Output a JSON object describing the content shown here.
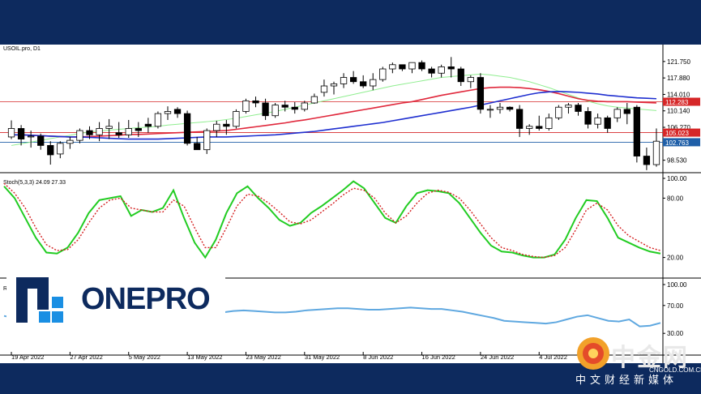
{
  "chart_data": [
    {
      "type": "candlestick",
      "title": "USOIL.pro, D1",
      "ylim": [
        95.6,
        124.2
      ],
      "y_ticks": [
        121.75,
        117.88,
        114.01,
        110.14,
        106.27,
        102.4,
        98.53
      ],
      "y_tick_labels": [
        "121.750",
        "117.880",
        "114.010",
        "110.140",
        "106.270",
        "",
        "98.530"
      ],
      "x_tick_labels": [
        "19 Apr 2022",
        "27 Apr 2022",
        "5 May 2022",
        "13 May 2022",
        "23 May 2022",
        "31 May 2022",
        "8 Jun 2022",
        "16 Jun 2022",
        "24 Jun 2022",
        "4 Jul 2022"
      ],
      "x_tick_index": [
        0,
        6,
        12,
        18,
        24,
        30,
        36,
        42,
        48,
        54
      ],
      "horizontal_lines": [
        {
          "value": 112.283,
          "label": "112.283",
          "color": "#d62728"
        },
        {
          "value": 105.023,
          "label": "105.023",
          "color": "#d62728"
        },
        {
          "value": 102.763,
          "label": "102.763",
          "color": "#1f5fa8"
        }
      ],
      "candles": [
        [
          104.0,
          107.9,
          103.5,
          106.0
        ],
        [
          106.0,
          106.8,
          102.0,
          103.5
        ],
        [
          104.0,
          105.5,
          101.5,
          104.2
        ],
        [
          104.2,
          104.8,
          101.0,
          102.0
        ],
        [
          102.0,
          103.0,
          97.5,
          99.8
        ],
        [
          100.0,
          103.0,
          99.0,
          102.5
        ],
        [
          102.5,
          104.0,
          101.2,
          103.2
        ],
        [
          103.2,
          106.0,
          102.5,
          105.5
        ],
        [
          105.5,
          106.5,
          103.5,
          104.5
        ],
        [
          104.5,
          107.5,
          103.0,
          106.0
        ],
        [
          106.0,
          108.2,
          103.5,
          106.5
        ],
        [
          105.0,
          107.5,
          103.8,
          104.5
        ],
        [
          104.5,
          108.0,
          103.8,
          106.0
        ],
        [
          106.0,
          107.5,
          104.0,
          105.5
        ],
        [
          107.0,
          108.5,
          105.0,
          106.5
        ],
        [
          106.5,
          110.0,
          106.0,
          109.5
        ],
        [
          109.5,
          111.2,
          108.0,
          110.0
        ],
        [
          110.5,
          111.0,
          108.5,
          109.5
        ],
        [
          109.5,
          110.2,
          102.0,
          102.5
        ],
        [
          102.5,
          104.0,
          101.0,
          101.0
        ],
        [
          101.0,
          106.0,
          100.0,
          105.5
        ],
        [
          105.5,
          107.8,
          104.0,
          107.0
        ],
        [
          107.0,
          108.0,
          104.5,
          106.5
        ],
        [
          106.5,
          110.5,
          106.0,
          110.0
        ],
        [
          110.0,
          113.0,
          109.5,
          112.5
        ],
        [
          112.5,
          113.5,
          111.0,
          112.0
        ],
        [
          112.0,
          113.0,
          108.0,
          109.0
        ],
        [
          109.0,
          112.0,
          108.5,
          111.5
        ],
        [
          111.5,
          112.5,
          110.0,
          111.0
        ],
        [
          111.0,
          112.2,
          109.5,
          110.5
        ],
        [
          110.5,
          112.5,
          110.0,
          112.0
        ],
        [
          112.0,
          114.2,
          111.8,
          113.5
        ],
        [
          114.5,
          117.5,
          113.5,
          116.0
        ],
        [
          116.0,
          117.0,
          114.0,
          116.5
        ],
        [
          116.5,
          119.0,
          115.5,
          118.0
        ],
        [
          118.0,
          119.5,
          116.5,
          117.0
        ],
        [
          117.0,
          118.5,
          115.5,
          116.0
        ],
        [
          116.0,
          119.0,
          115.0,
          117.5
        ],
        [
          117.5,
          120.5,
          117.0,
          120.0
        ],
        [
          120.0,
          121.5,
          119.0,
          121.0
        ],
        [
          121.0,
          121.0,
          119.5,
          120.0
        ],
        [
          120.0,
          121.5,
          119.0,
          121.5
        ],
        [
          121.5,
          122.0,
          119.5,
          120.0
        ],
        [
          120.0,
          120.5,
          118.0,
          119.0
        ],
        [
          119.0,
          121.0,
          118.0,
          120.5
        ],
        [
          120.5,
          122.8,
          118.0,
          120.0
        ],
        [
          120.0,
          120.5,
          116.0,
          117.0
        ],
        [
          117.0,
          118.5,
          115.5,
          118.0
        ],
        [
          118.0,
          119.0,
          109.5,
          110.5
        ],
        [
          110.5,
          111.5,
          108.5,
          110.5
        ],
        [
          110.5,
          112.0,
          109.5,
          111.0
        ],
        [
          111.0,
          111.2,
          110.0,
          110.5
        ],
        [
          110.5,
          111.5,
          104.0,
          106.0
        ],
        [
          106.0,
          107.0,
          104.5,
          106.5
        ],
        [
          106.5,
          109.0,
          105.5,
          106.0
        ],
        [
          106.0,
          109.5,
          105.5,
          108.5
        ],
        [
          108.5,
          111.5,
          108.0,
          111.0
        ],
        [
          111.0,
          112.0,
          109.5,
          111.5
        ],
        [
          111.5,
          112.0,
          109.0,
          110.0
        ],
        [
          110.0,
          111.0,
          106.0,
          107.0
        ],
        [
          107.0,
          109.5,
          106.0,
          108.5
        ],
        [
          108.5,
          109.0,
          105.0,
          106.0
        ],
        [
          108.5,
          111.0,
          107.5,
          110.5
        ],
        [
          110.5,
          112.0,
          107.0,
          109.5
        ],
        [
          111.0,
          111.5,
          98.0,
          99.5
        ],
        [
          99.5,
          101.5,
          96.2,
          97.5
        ],
        [
          97.5,
          106.0,
          97.0,
          103.0
        ]
      ],
      "series": [
        {
          "color": "#90ee90",
          "values": [
            102.0,
            102.4,
            102.8,
            103.2,
            103.6,
            104.0,
            104.4,
            104.8,
            105.2,
            105.4,
            105.6,
            105.8,
            106.0,
            106.2,
            106.3,
            106.5,
            106.8,
            107.0,
            107.2,
            107.4,
            107.6,
            107.8,
            108.1,
            108.4,
            108.8,
            109.2,
            109.6,
            110.0,
            110.5,
            111.0,
            111.5,
            112.0,
            112.5,
            113.0,
            113.5,
            114.0,
            114.5,
            115.0,
            115.5,
            116.0,
            116.4,
            116.8,
            117.2,
            117.6,
            118.0,
            118.2,
            118.4,
            118.6,
            118.8,
            118.6,
            118.3,
            118.0,
            117.5,
            117.0,
            116.3,
            115.6,
            114.8,
            114.0,
            113.2,
            112.4,
            111.8,
            111.3,
            111.0,
            110.8,
            110.6,
            110.4,
            110.2
          ]
        },
        {
          "color": "#e0283c",
          "values": [
            104.5,
            104.5,
            104.4,
            104.3,
            104.2,
            104.1,
            104.0,
            104.0,
            104.1,
            104.2,
            104.3,
            104.4,
            104.6,
            104.6,
            104.7,
            104.8,
            104.9,
            105.0,
            105.1,
            105.2,
            105.3,
            105.4,
            105.5,
            105.8,
            106.1,
            106.4,
            106.7,
            107.0,
            107.3,
            107.7,
            108.0,
            108.4,
            108.8,
            109.2,
            109.6,
            110.0,
            110.4,
            110.8,
            111.2,
            111.6,
            112.0,
            112.3,
            112.8,
            113.3,
            113.8,
            114.2,
            114.6,
            115.0,
            115.4,
            115.6,
            115.7,
            115.7,
            115.6,
            115.4,
            115.1,
            114.7,
            114.2,
            113.6,
            113.0,
            112.6,
            112.4,
            112.3,
            112.3,
            112.3,
            112.2,
            112.1,
            112.0
          ]
        },
        {
          "color": "#1f2fd0",
          "values": [
            104.5,
            104.5,
            104.4,
            104.3,
            104.2,
            104.1,
            104.0,
            104.0,
            103.9,
            103.8,
            103.7,
            103.6,
            103.5,
            103.5,
            103.5,
            103.5,
            103.6,
            103.7,
            103.8,
            103.9,
            104.0,
            104.0,
            104.0,
            104.1,
            104.2,
            104.3,
            104.4,
            104.5,
            104.7,
            104.9,
            105.1,
            105.3,
            105.6,
            105.9,
            106.2,
            106.5,
            106.8,
            107.1,
            107.4,
            107.8,
            108.2,
            108.6,
            109.0,
            109.4,
            109.8,
            110.2,
            110.6,
            111.0,
            111.5,
            112.0,
            112.5,
            113.0,
            113.5,
            114.0,
            114.4,
            114.6,
            114.7,
            114.6,
            114.5,
            114.3,
            114.1,
            113.8,
            113.6,
            113.4,
            113.2,
            113.1,
            113.0
          ]
        }
      ]
    },
    {
      "type": "line",
      "title": "Stoch(5,3,3) 24.09 27.33",
      "ylim": [
        0,
        100
      ],
      "y_ticks": [
        100,
        80,
        20
      ],
      "y_tick_labels": [
        "100.00",
        "80.00",
        "20.00"
      ],
      "series": [
        {
          "color": "#22cc22",
          "values": [
            92,
            80,
            60,
            40,
            25,
            24,
            30,
            45,
            65,
            78,
            80,
            82,
            62,
            68,
            66,
            70,
            88,
            60,
            35,
            20,
            38,
            65,
            85,
            92,
            80,
            70,
            58,
            52,
            55,
            65,
            72,
            80,
            88,
            97,
            90,
            75,
            60,
            55,
            72,
            85,
            88,
            87,
            85,
            75,
            60,
            45,
            32,
            26,
            25,
            22,
            20,
            20,
            23,
            38,
            60,
            78,
            77,
            60,
            40,
            35,
            30,
            26,
            24
          ]
        },
        {
          "color": "#d42020",
          "values": [
            95,
            85,
            70,
            50,
            33,
            27,
            28,
            38,
            55,
            70,
            78,
            80,
            70,
            68,
            66,
            66,
            78,
            72,
            50,
            30,
            30,
            50,
            72,
            84,
            82,
            75,
            66,
            56,
            54,
            58,
            66,
            74,
            83,
            90,
            88,
            80,
            65,
            55,
            62,
            75,
            85,
            88,
            86,
            80,
            68,
            54,
            40,
            30,
            27,
            23,
            21,
            20,
            22,
            30,
            48,
            68,
            75,
            68,
            52,
            42,
            36,
            30,
            27
          ]
        }
      ]
    },
    {
      "type": "line",
      "title": "RSI(14) 40.33",
      "ylim": [
        0,
        100
      ],
      "y_ticks": [
        100,
        70,
        30
      ],
      "y_tick_labels": [
        "100.00",
        "70.00",
        "30.00"
      ],
      "series": [
        {
          "color": "#5fa8e0",
          "values": [
            55,
            52,
            50,
            50,
            48,
            50,
            52,
            54,
            55,
            56,
            57,
            58,
            57,
            58,
            59,
            60,
            62,
            58,
            54,
            53,
            56,
            60,
            62,
            63,
            62,
            61,
            60,
            60,
            61,
            63,
            64,
            65,
            66,
            66,
            65,
            64,
            64,
            65,
            66,
            67,
            66,
            65,
            65,
            63,
            61,
            58,
            55,
            52,
            48,
            47,
            46,
            45,
            44,
            46,
            50,
            54,
            56,
            52,
            48,
            47,
            50,
            40,
            41,
            45
          ]
        }
      ]
    }
  ],
  "branding": {
    "onepro_text": "ONEPRO",
    "cngold_title": "中金网",
    "cngold_url": "CNGOLD.COM.CN",
    "cngold_sub": "中文财经新媒体"
  }
}
